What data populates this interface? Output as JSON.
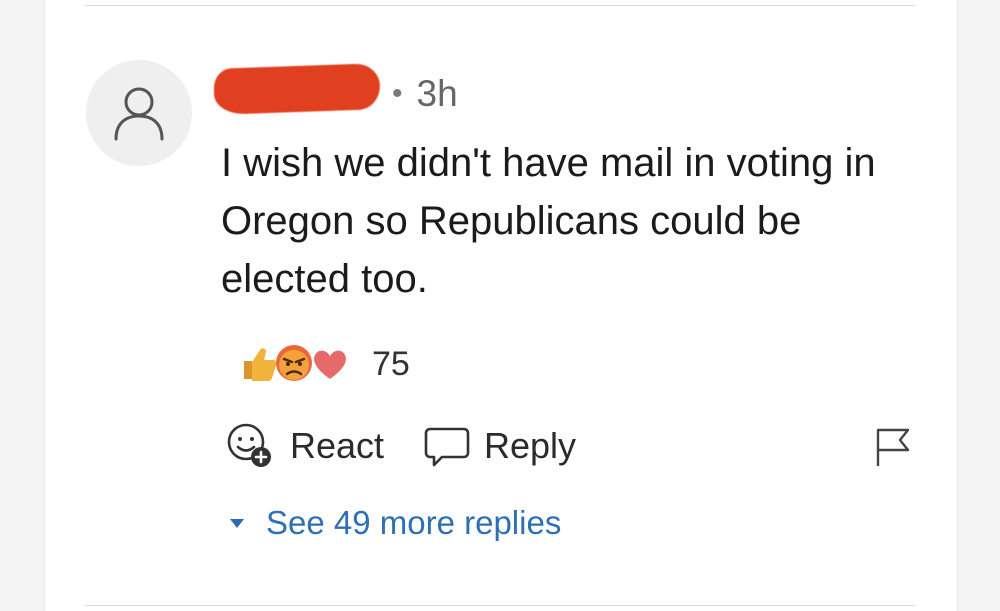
{
  "comment": {
    "author_redacted": true,
    "time_ago": "3h",
    "separator": "•",
    "text": "I wish we didn't have mail in voting in Oregon so Republicans could be elected too."
  },
  "reactions": {
    "icons": [
      "thumbs-up-icon",
      "angry-face-icon",
      "heart-icon"
    ],
    "count": "75"
  },
  "actions": {
    "react_label": "React",
    "reply_label": "Reply"
  },
  "replies": {
    "see_more_label": "See 49 more replies"
  },
  "colors": {
    "link": "#2f6fb5",
    "redaction": "#e0401f",
    "text": "#1b1b1b",
    "muted": "#666666"
  }
}
